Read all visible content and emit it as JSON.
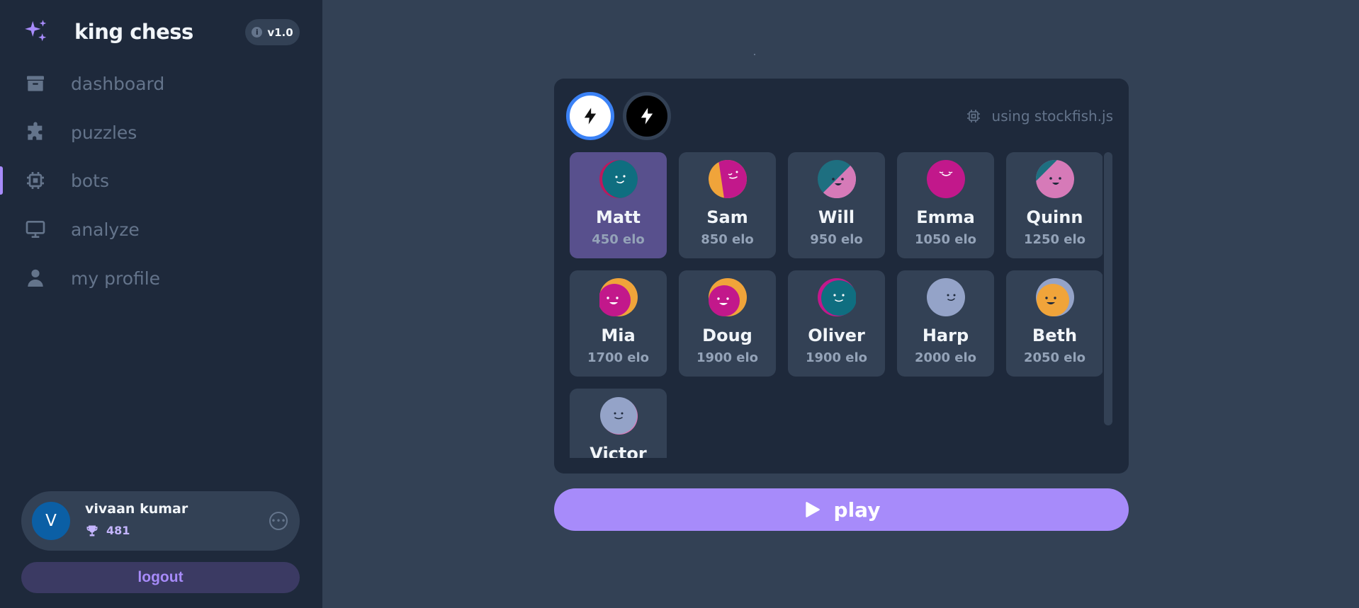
{
  "app": {
    "name": "king chess",
    "version": "v1.0",
    "version_icon": "info-icon",
    "logo_icon": "sparkles-icon"
  },
  "nav": {
    "items": [
      {
        "label": "dashboard",
        "icon": "archive-icon",
        "active": false
      },
      {
        "label": "puzzles",
        "icon": "puzzle-icon",
        "active": false
      },
      {
        "label": "bots",
        "icon": "chip-icon",
        "active": true
      },
      {
        "label": "analyze",
        "icon": "monitor-icon",
        "active": false
      },
      {
        "label": "my profile",
        "icon": "user-icon",
        "active": false
      }
    ]
  },
  "user": {
    "initial": "V",
    "name": "vivaan kumar",
    "rating": "481",
    "rating_icon": "trophy-icon",
    "menu_icon": "more-icon"
  },
  "logout_label": "logout",
  "engine_label": "using stockfish.js",
  "color_choice": {
    "selected": "white",
    "options": [
      "white",
      "black"
    ],
    "icon": "lightning-icon"
  },
  "bots": [
    {
      "name": "Matt",
      "elo": "450 elo",
      "selected": true
    },
    {
      "name": "Sam",
      "elo": "850 elo",
      "selected": false
    },
    {
      "name": "Will",
      "elo": "950 elo",
      "selected": false
    },
    {
      "name": "Emma",
      "elo": "1050 elo",
      "selected": false
    },
    {
      "name": "Quinn",
      "elo": "1250 elo",
      "selected": false
    },
    {
      "name": "Mia",
      "elo": "1700 elo",
      "selected": false
    },
    {
      "name": "Doug",
      "elo": "1900 elo",
      "selected": false
    },
    {
      "name": "Oliver",
      "elo": "1900 elo",
      "selected": false
    },
    {
      "name": "Harp",
      "elo": "2000 elo",
      "selected": false
    },
    {
      "name": "Beth",
      "elo": "2050 elo",
      "selected": false
    },
    {
      "name": "Victor",
      "elo": "",
      "selected": false
    }
  ],
  "play_label": "play",
  "colors": {
    "accent": "#a78bfa",
    "sidebar": "#1e293b",
    "background": "#334155",
    "selected_card": "#58508d",
    "white_ring": "#3b82f6"
  }
}
